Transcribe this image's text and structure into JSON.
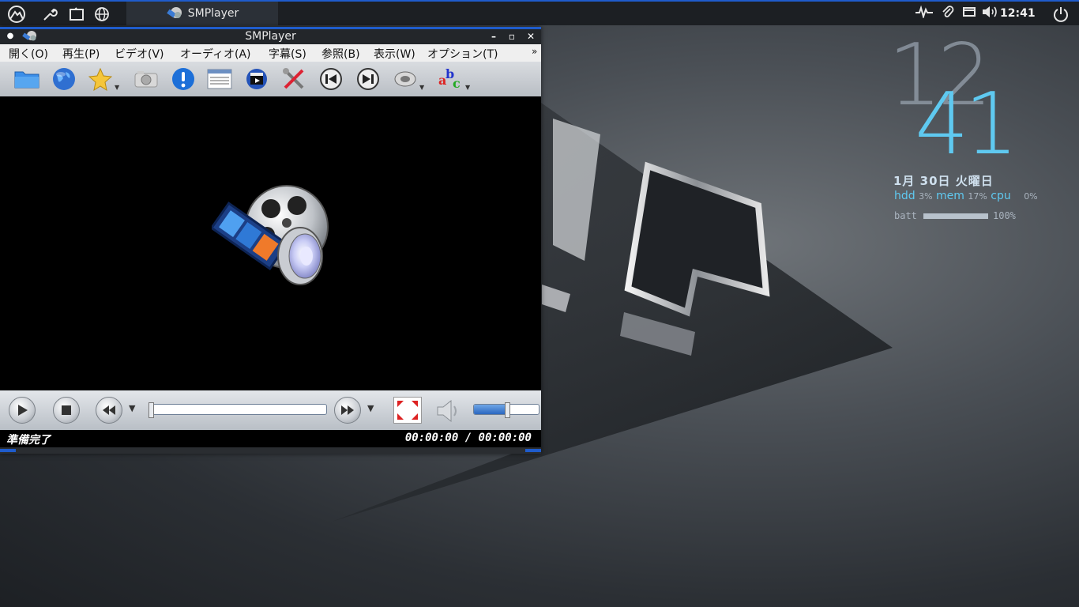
{
  "panel": {
    "task_title": "SMPlayer",
    "clock": "12:41",
    "launchers": [
      "app-menu-icon",
      "settings-wrench-icon",
      "file-manager-icon",
      "web-browser-icon"
    ],
    "tray_icons": [
      "system-monitor-icon",
      "paperclip-icon",
      "network-icon",
      "volume-icon"
    ],
    "power_icon": "power-icon"
  },
  "window": {
    "title": "SMPlayer",
    "menu": [
      "開く(O)",
      "再生(P)",
      "ビデオ(V)",
      "オーディオ(A)",
      "字幕(S)",
      "参照(B)",
      "表示(W)",
      "オプション(T)"
    ],
    "menu_overflow": "»",
    "toolbar_icons": [
      "open-folder-icon",
      "open-url-globe-icon",
      "favorites-star-icon",
      "screenshot-camera-icon",
      "info-exclamation-icon",
      "playlist-icon",
      "media-clapper-icon",
      "preferences-tools-icon",
      "previous-track-icon",
      "next-track-icon",
      "audio-track-icon",
      "subtitles-abc-icon"
    ],
    "status_left": "準備完了",
    "status_time": "00:00:00 / 00:00:00",
    "seek_position": 0,
    "volume_level": 0.5
  },
  "conky": {
    "hour": "12",
    "minute": "41",
    "date": "1月 30日 火曜日",
    "hdd_label": "hdd",
    "hdd_value": "3%",
    "mem_label": "mem",
    "mem_value": "17%",
    "cpu_label": "cpu",
    "cpu_value": "0%",
    "batt_label": "batt",
    "batt_value": "100%",
    "batt_level": 1.0
  },
  "colors": {
    "accent": "#1f5ccc",
    "conky_cyan": "#5fc9f0"
  }
}
